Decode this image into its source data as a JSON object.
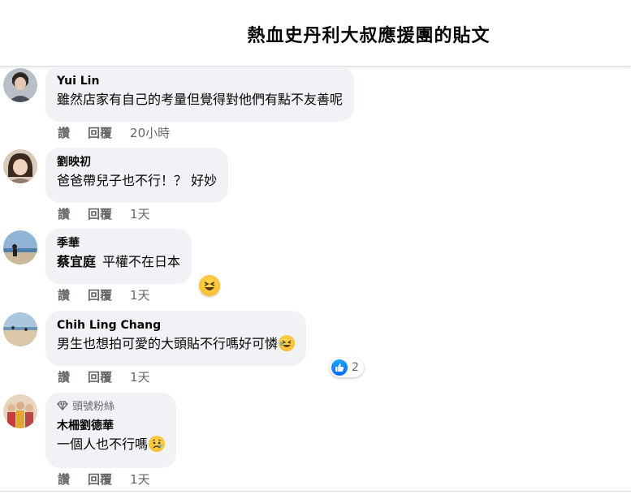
{
  "header": {
    "title": "熱血史丹利大叔應援團的貼文"
  },
  "actions": {
    "like": "讚",
    "reply": "回覆"
  },
  "comments": [
    {
      "author": "Yui Lin",
      "text": "雖然店家有自己的考量但覺得對他們有點不友善呢",
      "time": "20小時"
    },
    {
      "author": "劉映初",
      "text": "爸爸帶兒子也不行！？ 好妙",
      "time": "1天"
    },
    {
      "author": "季華",
      "mention": "蔡宜庭",
      "text": "平權不在日本",
      "time": "1天",
      "reaction_emoji": "laughing-emoji"
    },
    {
      "author": "Chih Ling Chang",
      "text": "男生也想拍可愛的大頭貼不行嗎好可憐",
      "time": "1天",
      "inline_emoji": "laughing-emoji",
      "like_count": "2"
    },
    {
      "badge": "頭號粉絲",
      "author": "木柵劉德華",
      "text": "一個人也不行嗎",
      "time": "1天",
      "inline_emoji": "sad-emoji"
    }
  ],
  "colors": {
    "bubble": "#f0f2f5",
    "secondary_text": "#65676b",
    "like_blue": "#0866ff"
  }
}
